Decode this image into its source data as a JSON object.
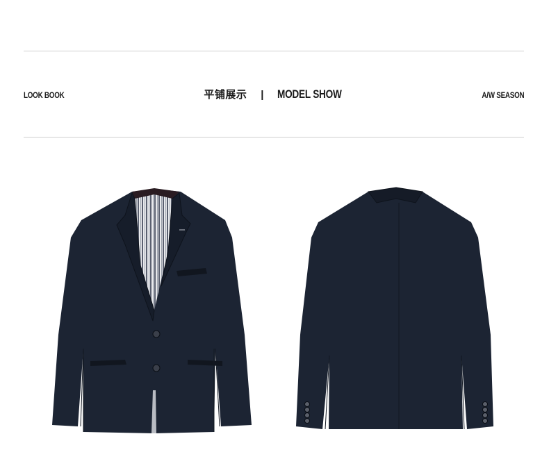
{
  "header": {
    "left_label": "LOOK BOOK",
    "title_cn": "平铺展示",
    "separator": "|",
    "title_en": "MODEL SHOW",
    "right_label": "A/W SEASON"
  },
  "colors": {
    "jacket": "#1c2433",
    "lining_stripe_dark": "#5a6070",
    "lining_stripe_light": "#e8e9ec",
    "rule": "#cfcfcf"
  },
  "images": {
    "front": "jacket-front-image",
    "back": "jacket-back-image"
  }
}
